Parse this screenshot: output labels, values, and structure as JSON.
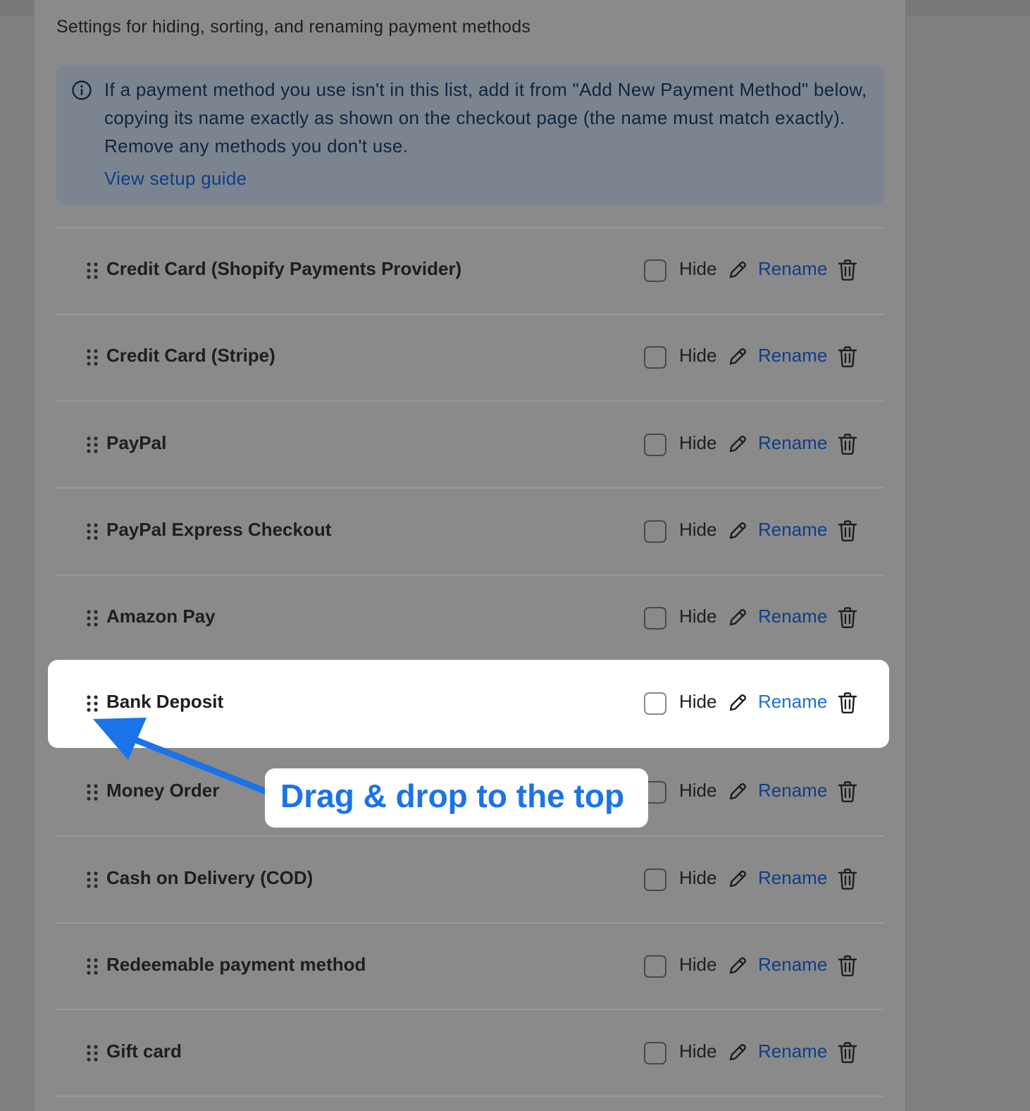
{
  "header": {
    "subtitle": "Settings for hiding, sorting, and renaming payment methods"
  },
  "info_banner": {
    "icon": "info-icon",
    "message": "If a payment method you use isn't in this list, add it from \"Add New Payment Method\" below, copying its name exactly as shown on the checkout page (the name must match exactly). Remove any methods you don't use.",
    "link_label": "View setup guide"
  },
  "row_controls": {
    "hide_label": "Hide",
    "rename_label": "Rename",
    "drag_icon": "drag-handle-icon",
    "edit_icon": "pencil-icon",
    "delete_icon": "trash-icon"
  },
  "payment_methods": [
    {
      "name": "Credit Card (Shopify Payments Provider)",
      "hidden": false
    },
    {
      "name": "Credit Card (Stripe)",
      "hidden": false
    },
    {
      "name": "PayPal",
      "hidden": false
    },
    {
      "name": "PayPal Express Checkout",
      "hidden": false
    },
    {
      "name": "Amazon Pay",
      "hidden": false
    },
    {
      "name": "Bank Deposit",
      "hidden": false,
      "highlighted": true
    },
    {
      "name": "Money Order",
      "hidden": false
    },
    {
      "name": "Cash on Delivery (COD)",
      "hidden": false
    },
    {
      "name": "Redeemable payment method",
      "hidden": false
    },
    {
      "name": "Gift card",
      "hidden": false
    }
  ],
  "annotation": {
    "text": "Drag & drop to the top",
    "color": "#1a73e8"
  },
  "colors": {
    "link": "#0e3e8c",
    "accent": "#1a73e8"
  }
}
